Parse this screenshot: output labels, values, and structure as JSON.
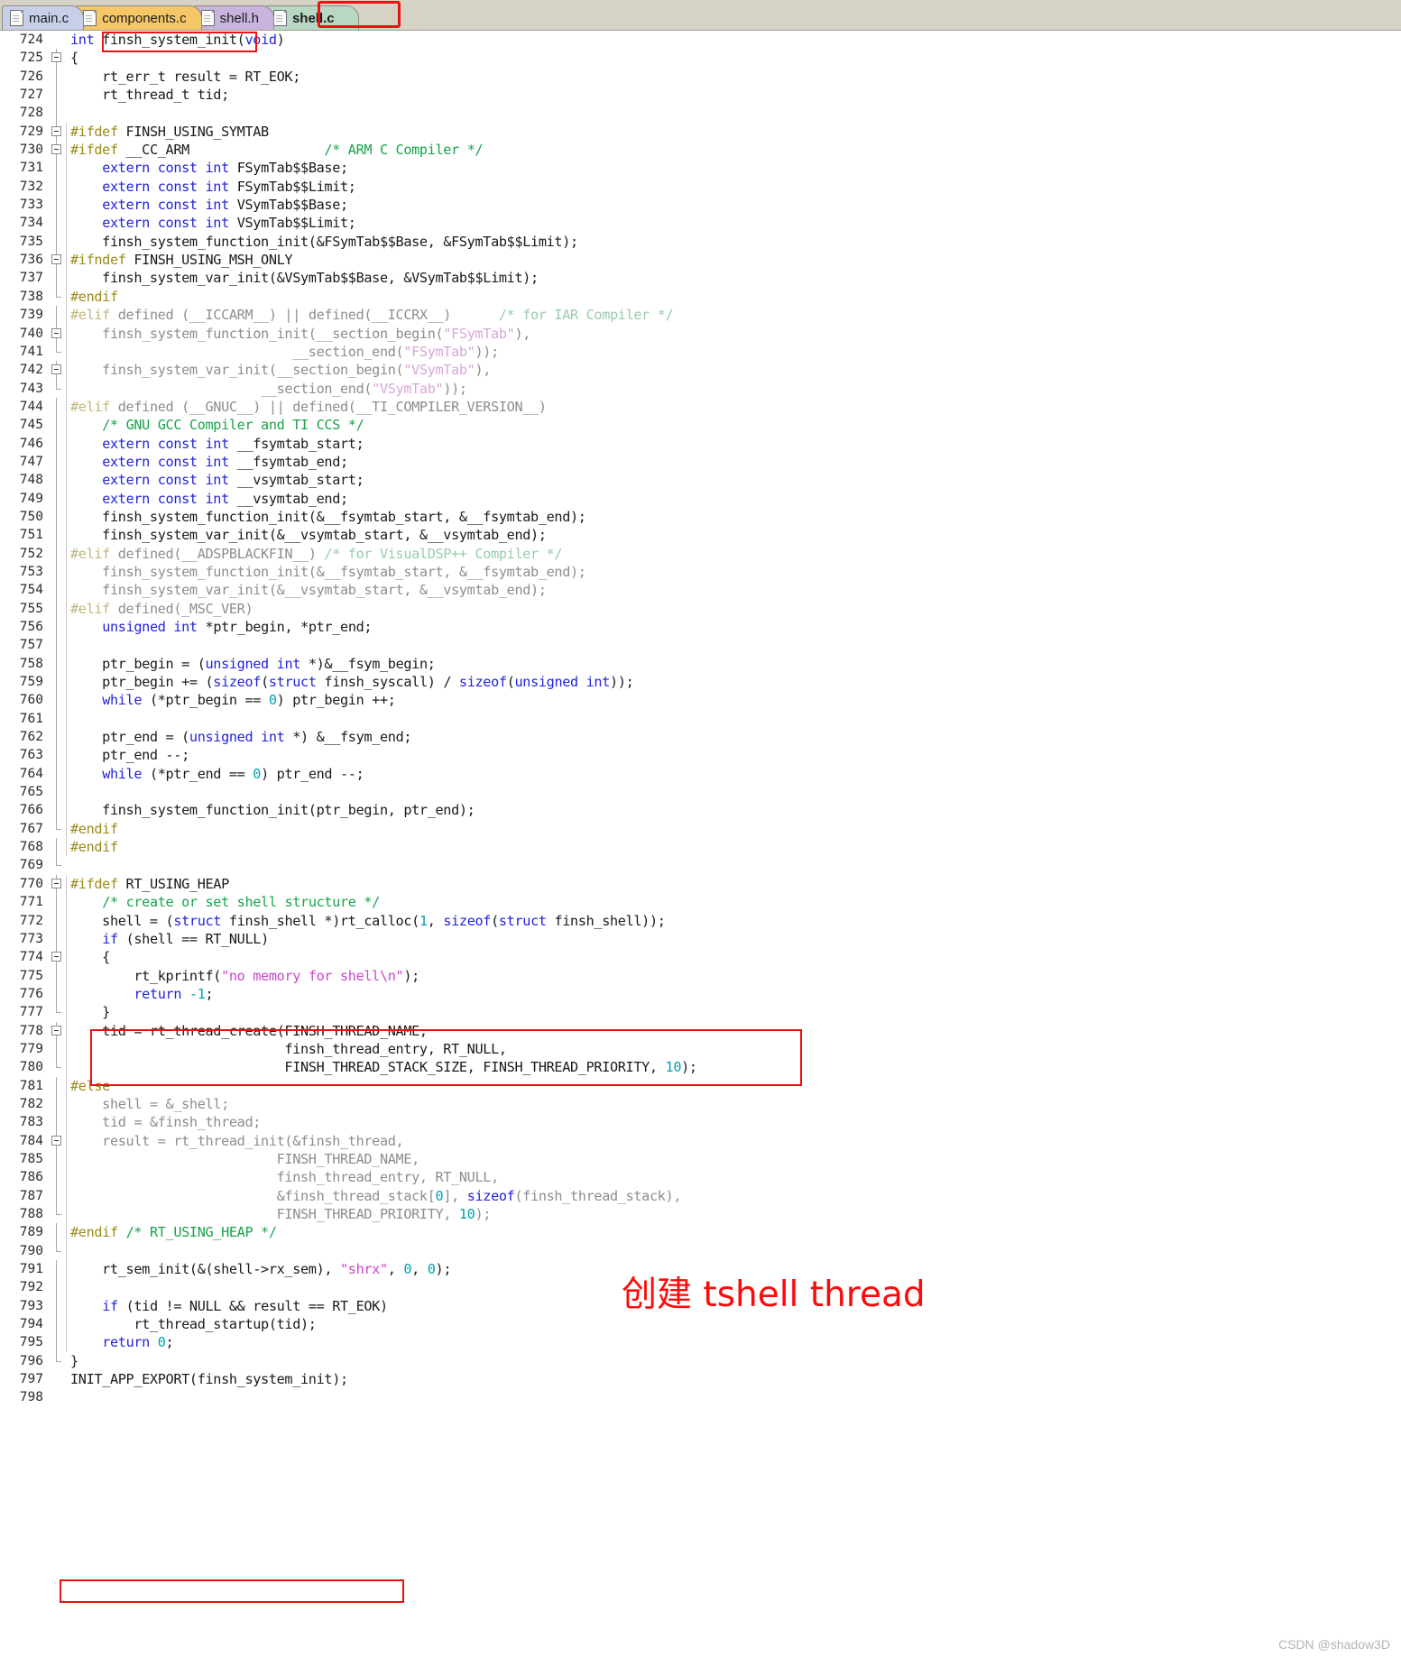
{
  "window": {
    "watermark": "CSDN @shadow3D"
  },
  "tabs": [
    {
      "label": "main.c",
      "icon": "document-icon",
      "active": false
    },
    {
      "label": "components.c",
      "icon": "document-icon",
      "active": false
    },
    {
      "label": "shell.h",
      "icon": "document-icon",
      "active": false
    },
    {
      "label": "shell.c",
      "icon": "document-icon",
      "active": true
    }
  ],
  "annotations": {
    "chinese_note": "创建 tshell thread",
    "note_color": "#ff0a0a",
    "highlight_color": "#ee1111",
    "boxes": [
      {
        "name": "active-tab-highlight",
        "target": "shell.c tab"
      },
      {
        "name": "function-name-highlight",
        "target": "finsh_system_init"
      },
      {
        "name": "thread-create-highlight",
        "target": "rt_thread_create call lines 778-780"
      },
      {
        "name": "init-app-export-highlight",
        "target": "INIT_APP_EXPORT line 797"
      }
    ]
  },
  "editor": {
    "first_line": 724,
    "last_line": 798,
    "lines": [
      {
        "n": 724,
        "fold": "none",
        "html": "<span class=\"kw\">int</span> finsh_system_init(<span class=\"kw\">void</span>)"
      },
      {
        "n": 725,
        "fold": "open",
        "html": "{"
      },
      {
        "n": 726,
        "fold": "bar",
        "html": "    rt_err_t result = RT_EOK;"
      },
      {
        "n": 727,
        "fold": "bar",
        "html": "    rt_thread_t tid;"
      },
      {
        "n": 728,
        "fold": "bar",
        "html": ""
      },
      {
        "n": 729,
        "fold": "open2",
        "html": "<span class=\"pp\">#ifdef</span> FINSH_USING_SYMTAB"
      },
      {
        "n": 730,
        "fold": "open2",
        "html": "<span class=\"pp\">#ifdef</span> __CC_ARM                 <span class=\"cm\">/* ARM C Compiler */</span>"
      },
      {
        "n": 731,
        "fold": "bar2",
        "html": "    <span class=\"kw\">extern</span> <span class=\"kw\">const</span> <span class=\"kw\">int</span> FSymTab$$Base;"
      },
      {
        "n": 732,
        "fold": "bar2",
        "html": "    <span class=\"kw\">extern</span> <span class=\"kw\">const</span> <span class=\"kw\">int</span> FSymTab$$Limit;"
      },
      {
        "n": 733,
        "fold": "bar2",
        "html": "    <span class=\"kw\">extern</span> <span class=\"kw\">const</span> <span class=\"kw\">int</span> VSymTab$$Base;"
      },
      {
        "n": 734,
        "fold": "bar2",
        "html": "    <span class=\"kw\">extern</span> <span class=\"kw\">const</span> <span class=\"kw\">int</span> VSymTab$$Limit;"
      },
      {
        "n": 735,
        "fold": "bar2",
        "html": "    finsh_system_function_init(&amp;FSymTab$$Base, &amp;FSymTab$$Limit);"
      },
      {
        "n": 736,
        "fold": "open2",
        "html": "<span class=\"pp\">#ifndef</span> FINSH_USING_MSH_ONLY"
      },
      {
        "n": 737,
        "fold": "bar2",
        "html": "    finsh_system_var_init(&amp;VSymTab$$Base, &amp;VSymTab$$Limit);"
      },
      {
        "n": 738,
        "fold": "end2",
        "html": "<span class=\"pp\">#endif</span>"
      },
      {
        "n": 739,
        "fold": "bar2",
        "html": "<span class=\"graypp\">#elif</span> <span class=\"gray\">defined (__ICCARM__) || defined(__ICCRX__)      </span><span class=\"graycm\">/* for IAR Compiler */</span>"
      },
      {
        "n": 740,
        "fold": "open2",
        "html": "<span class=\"gray\">    finsh_system_function_init(__section_begin(</span><span class=\"grayst\">\"FSymTab\"</span><span class=\"gray\">),</span>"
      },
      {
        "n": 741,
        "fold": "end2",
        "html": "<span class=\"gray\">                            __section_end(</span><span class=\"grayst\">\"FSymTab\"</span><span class=\"gray\">));</span>"
      },
      {
        "n": 742,
        "fold": "open2",
        "html": "<span class=\"gray\">    finsh_system_var_init(__section_begin(</span><span class=\"grayst\">\"VSymTab\"</span><span class=\"gray\">),</span>"
      },
      {
        "n": 743,
        "fold": "end2",
        "html": "<span class=\"gray\">                        __section_end(</span><span class=\"grayst\">\"VSymTab\"</span><span class=\"gray\">));</span>"
      },
      {
        "n": 744,
        "fold": "bar2",
        "html": "<span class=\"graypp\">#elif</span> <span class=\"gray\">defined (__GNUC__) || defined(__TI_COMPILER_VERSION__)</span>"
      },
      {
        "n": 745,
        "fold": "bar2",
        "html": "    <span class=\"cm\">/* GNU GCC Compiler and TI CCS */</span>"
      },
      {
        "n": 746,
        "fold": "bar2",
        "html": "    <span class=\"kw\">extern</span> <span class=\"kw\">const</span> <span class=\"kw\">int</span> __fsymtab_start;"
      },
      {
        "n": 747,
        "fold": "bar2",
        "html": "    <span class=\"kw\">extern</span> <span class=\"kw\">const</span> <span class=\"kw\">int</span> __fsymtab_end;"
      },
      {
        "n": 748,
        "fold": "bar2",
        "html": "    <span class=\"kw\">extern</span> <span class=\"kw\">const</span> <span class=\"kw\">int</span> __vsymtab_start;"
      },
      {
        "n": 749,
        "fold": "bar2",
        "html": "    <span class=\"kw\">extern</span> <span class=\"kw\">const</span> <span class=\"kw\">int</span> __vsymtab_end;"
      },
      {
        "n": 750,
        "fold": "bar2",
        "html": "    finsh_system_function_init(&amp;__fsymtab_start, &amp;__fsymtab_end);"
      },
      {
        "n": 751,
        "fold": "bar2",
        "html": "    finsh_system_var_init(&amp;__vsymtab_start, &amp;__vsymtab_end);"
      },
      {
        "n": 752,
        "fold": "bar2",
        "html": "<span class=\"graypp\">#elif</span> <span class=\"gray\">defined(__ADSPBLACKFIN__) </span><span class=\"graycm\">/* for VisualDSP++ Compiler */</span>"
      },
      {
        "n": 753,
        "fold": "bar2",
        "html": "<span class=\"gray\">    finsh_system_function_init(&amp;__fsymtab_start, &amp;__fsymtab_end);</span>"
      },
      {
        "n": 754,
        "fold": "bar2",
        "html": "<span class=\"gray\">    finsh_system_var_init(&amp;__vsymtab_start, &amp;__vsymtab_end);</span>"
      },
      {
        "n": 755,
        "fold": "bar2",
        "html": "<span class=\"graypp\">#elif</span> <span class=\"gray\">defined(_MSC_VER)</span>"
      },
      {
        "n": 756,
        "fold": "bar2",
        "html": "    <span class=\"kw\">unsigned</span> <span class=\"kw\">int</span> *ptr_begin, *ptr_end;"
      },
      {
        "n": 757,
        "fold": "bar2",
        "html": ""
      },
      {
        "n": 758,
        "fold": "bar2",
        "html": "    ptr_begin = (<span class=\"kw\">unsigned</span> <span class=\"kw\">int</span> *)&amp;__fsym_begin;"
      },
      {
        "n": 759,
        "fold": "bar2",
        "html": "    ptr_begin += (<span class=\"kw\">sizeof</span>(<span class=\"kw\">struct</span> finsh_syscall) / <span class=\"kw\">sizeof</span>(<span class=\"kw\">unsigned</span> <span class=\"kw\">int</span>));"
      },
      {
        "n": 760,
        "fold": "bar2",
        "html": "    <span class=\"kw\">while</span> (*ptr_begin == <span class=\"nm\">0</span>) ptr_begin ++;"
      },
      {
        "n": 761,
        "fold": "bar2",
        "html": ""
      },
      {
        "n": 762,
        "fold": "bar2",
        "html": "    ptr_end = (<span class=\"kw\">unsigned</span> <span class=\"kw\">int</span> *) &amp;__fsym_end;"
      },
      {
        "n": 763,
        "fold": "bar2",
        "html": "    ptr_end --;"
      },
      {
        "n": 764,
        "fold": "bar2",
        "html": "    <span class=\"kw\">while</span> (*ptr_end == <span class=\"nm\">0</span>) ptr_end --;"
      },
      {
        "n": 765,
        "fold": "bar2",
        "html": ""
      },
      {
        "n": 766,
        "fold": "bar2",
        "html": "    finsh_system_function_init(ptr_begin, ptr_end);"
      },
      {
        "n": 767,
        "fold": "end2",
        "html": "<span class=\"pp\">#endif</span>"
      },
      {
        "n": 768,
        "fold": "bar2",
        "html": "<span class=\"pp\">#endif</span>"
      },
      {
        "n": 769,
        "fold": "end",
        "html": ""
      },
      {
        "n": 770,
        "fold": "open2",
        "html": "<span class=\"pp\">#ifdef</span> RT_USING_HEAP"
      },
      {
        "n": 771,
        "fold": "bar2",
        "html": "    <span class=\"cm\">/* create or set shell structure */</span>"
      },
      {
        "n": 772,
        "fold": "bar2",
        "html": "    shell = (<span class=\"kw\">struct</span> finsh_shell *)rt_calloc(<span class=\"nm\">1</span>, <span class=\"kw\">sizeof</span>(<span class=\"kw\">struct</span> finsh_shell));"
      },
      {
        "n": 773,
        "fold": "bar2",
        "html": "    <span class=\"kw\">if</span> (shell == RT_NULL)"
      },
      {
        "n": 774,
        "fold": "open2",
        "html": "    {"
      },
      {
        "n": 775,
        "fold": "bar2",
        "html": "        rt_kprintf(<span class=\"st\">\"no memory for shell\\n\"</span>);"
      },
      {
        "n": 776,
        "fold": "bar2",
        "html": "        <span class=\"kw\">return</span> <span class=\"nm\">-1</span>;"
      },
      {
        "n": 777,
        "fold": "end2",
        "html": "    }"
      },
      {
        "n": 778,
        "fold": "open2",
        "html": "    tid = rt_thread_create(FINSH_THREAD_NAME,"
      },
      {
        "n": 779,
        "fold": "bar2",
        "html": "                           finsh_thread_entry, RT_NULL,"
      },
      {
        "n": 780,
        "fold": "end2",
        "html": "                           FINSH_THREAD_STACK_SIZE, FINSH_THREAD_PRIORITY, <span class=\"nm\">10</span>);"
      },
      {
        "n": 781,
        "fold": "bar2",
        "html": "<span class=\"pp\">#else</span>"
      },
      {
        "n": 782,
        "fold": "bar2",
        "html": "<span class=\"gray\">    shell = &amp;_shell;</span>"
      },
      {
        "n": 783,
        "fold": "bar2",
        "html": "<span class=\"gray\">    tid = &amp;finsh_thread;</span>"
      },
      {
        "n": 784,
        "fold": "open2",
        "html": "<span class=\"gray\">    result = rt_thread_init(&amp;finsh_thread,</span>"
      },
      {
        "n": 785,
        "fold": "bar2",
        "html": "<span class=\"gray\">                          FINSH_THREAD_NAME,</span>"
      },
      {
        "n": 786,
        "fold": "bar2",
        "html": "<span class=\"gray\">                          finsh_thread_entry, RT_NULL,</span>"
      },
      {
        "n": 787,
        "fold": "bar2",
        "html": "<span class=\"gray\">                          &amp;finsh_thread_stack[</span><span class=\"nm\">0</span><span class=\"gray\">], </span><span class=\"kw\">sizeof</span><span class=\"gray\">(finsh_thread_stack),</span>"
      },
      {
        "n": 788,
        "fold": "end2",
        "html": "<span class=\"gray\">                          FINSH_THREAD_PRIORITY, </span><span class=\"nm\">10</span><span class=\"gray\">);</span>"
      },
      {
        "n": 789,
        "fold": "bar2",
        "html": "<span class=\"pp\">#endif</span> <span class=\"cm\">/* RT_USING_HEAP */</span>"
      },
      {
        "n": 790,
        "fold": "end2",
        "html": ""
      },
      {
        "n": 791,
        "fold": "bar2",
        "html": "    rt_sem_init(&amp;(shell-&gt;rx_sem), <span class=\"st\">\"shrx\"</span>, <span class=\"nm\">0</span>, <span class=\"nm\">0</span>);"
      },
      {
        "n": 792,
        "fold": "bar2",
        "html": ""
      },
      {
        "n": 793,
        "fold": "bar2",
        "html": "    <span class=\"kw\">if</span> (tid != NULL &amp;&amp; result == RT_EOK)"
      },
      {
        "n": 794,
        "fold": "bar2",
        "html": "        rt_thread_startup(tid);"
      },
      {
        "n": 795,
        "fold": "bar2",
        "html": "    <span class=\"kw\">return</span> <span class=\"nm\">0</span>;"
      },
      {
        "n": 796,
        "fold": "end",
        "html": "}"
      },
      {
        "n": 797,
        "fold": "none",
        "html": "INIT_APP_EXPORT(finsh_system_init);"
      },
      {
        "n": 798,
        "fold": "none",
        "html": ""
      }
    ]
  }
}
